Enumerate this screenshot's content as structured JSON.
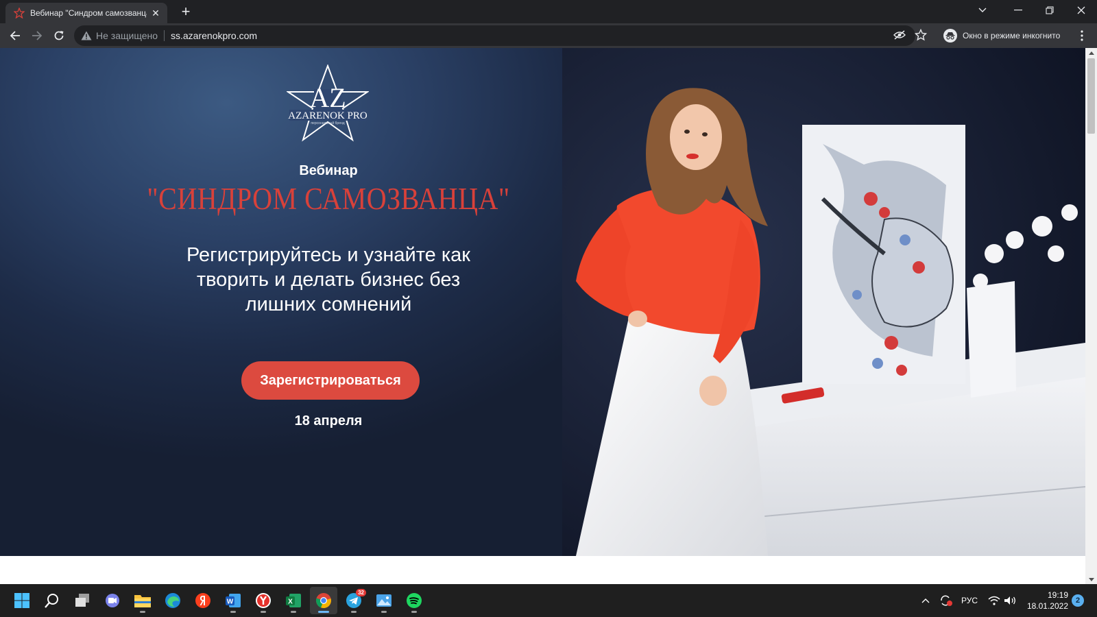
{
  "browser": {
    "tab": {
      "title": "Вебинар \"Синдром самозванца\"",
      "close_glyph": "✕"
    },
    "new_tab_glyph": "+",
    "address_bar": {
      "security_label": "Не защищено",
      "url": "ss.azarenokpro.com"
    },
    "incognito_label": "Окно в режиме инкогнито"
  },
  "page": {
    "logo": {
      "monogram": "AZ",
      "brand": "AZARENOK PRO",
      "tagline": "персональный бренд"
    },
    "webinar_label": "Вебинар",
    "headline": "\"СИНДРОМ САМОЗВАНЦА\"",
    "subtitle": "Регистрируйтесь и узнайте как творить и делать бизнес без лишних сомнений",
    "cta_label": "Зарегистрироваться",
    "date": "18 апреля"
  },
  "taskbar": {
    "icons": [
      "windows-start",
      "search",
      "task-view",
      "teams-chat",
      "file-explorer",
      "edge",
      "yandex",
      "word",
      "yandex-browser",
      "excel",
      "chrome",
      "telegram",
      "photos",
      "spotify"
    ],
    "telegram_badge": "32",
    "tray": {
      "language": "РУС",
      "time": "19:19",
      "date": "18.01.2022",
      "notifications": "2"
    }
  },
  "colors": {
    "accent_red": "#d8413a",
    "cta_bg": "#dc4a3f",
    "hero_bg": "#2b4166"
  }
}
